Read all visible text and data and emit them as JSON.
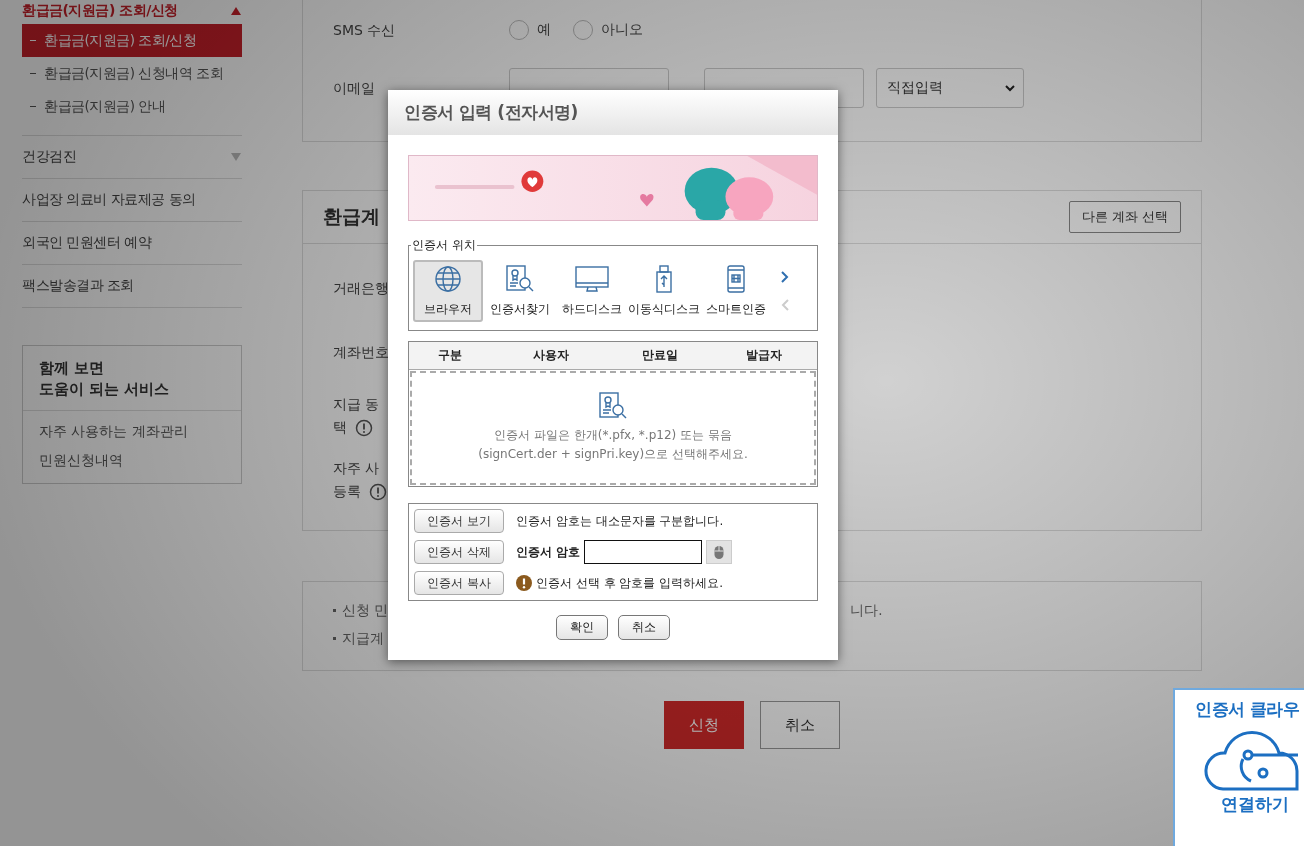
{
  "sidebar": {
    "menu": [
      {
        "label": "환급금(지원금) 조회/신청",
        "kind": "group",
        "expanded": true,
        "children": [
          {
            "label": "환급금(지원금) 조회/신청",
            "selected": true
          },
          {
            "label": "환급금(지원금) 신청내역 조회",
            "selected": false
          },
          {
            "label": "환급금(지원금) 안내",
            "selected": false
          }
        ]
      },
      {
        "label": "건강검진",
        "kind": "group",
        "expanded": false
      },
      {
        "label": "사업장 의료비 자료제공 동의",
        "kind": "link"
      },
      {
        "label": "외국인 민원센터 예약",
        "kind": "link"
      },
      {
        "label": "팩스발송결과 조회",
        "kind": "link"
      }
    ],
    "related": {
      "title": "함께 보면\n도움이 되는 서비스",
      "links": [
        "자주 사용하는 계좌관리",
        "민원신청내역"
      ]
    }
  },
  "contact_form": {
    "rows": [
      {
        "kind": "radio",
        "label": "SMS 수신",
        "options": [
          {
            "label": "예",
            "selected": false
          },
          {
            "label": "아니오",
            "selected": false
          }
        ]
      },
      {
        "kind": "email",
        "label": "이메일",
        "domain_select": "직접입력"
      }
    ]
  },
  "account_section": {
    "title": "환급계",
    "action": "다른 계좌 선택",
    "rows": [
      {
        "label_lines": [
          "거래은행"
        ],
        "info": false
      },
      {
        "label_lines": [
          "계좌번호"
        ],
        "info": false
      },
      {
        "label_lines": [
          "지급 동",
          "택"
        ],
        "info": true
      },
      {
        "label_lines": [
          "자주 사",
          "등록"
        ],
        "info": true
      }
    ]
  },
  "notes": [
    {
      "text": "신청 민",
      "tail": "니다."
    },
    {
      "text": "지급계"
    }
  ],
  "actions": [
    {
      "label": "신청",
      "kind": "primary"
    },
    {
      "label": "취소",
      "kind": "secondary"
    }
  ],
  "dialog": {
    "title": "인증서 입력 (전자서명)",
    "banner": {
      "kind": "picture"
    },
    "location": {
      "legend": "인증서 위치",
      "options": [
        {
          "label": "브라우저",
          "kind": "globe",
          "selected": true
        },
        {
          "label": "인증서찾기",
          "kind": "search",
          "selected": false
        },
        {
          "label": "하드디스크",
          "kind": "monitor",
          "selected": false
        },
        {
          "label": "이동식디스크",
          "kind": "usb",
          "selected": false
        },
        {
          "label": "스마트인증",
          "kind": "phone",
          "selected": false
        }
      ]
    },
    "cert_table": {
      "columns": [
        "구분",
        "사용자",
        "만료일",
        "발급자"
      ],
      "empty_message": "인증서 파일은 한개(*.pfx, *.p12) 또는 묶음\n(signCert.der + signPri.key)으로 선택해주세요."
    },
    "cert_actions": {
      "buttons": [
        "인증서 보기",
        "인증서 삭제",
        "인증서 복사"
      ],
      "case_note": "인증서 암호는 대소문자를 구분합니다.",
      "password_label": "인증서 암호",
      "warning": "인증서 선택 후 암호를 입력하세요."
    },
    "buttons": [
      "확인",
      "취소"
    ]
  },
  "cloud_badge": {
    "title": "인증서 클라우",
    "action": "연결하기"
  }
}
